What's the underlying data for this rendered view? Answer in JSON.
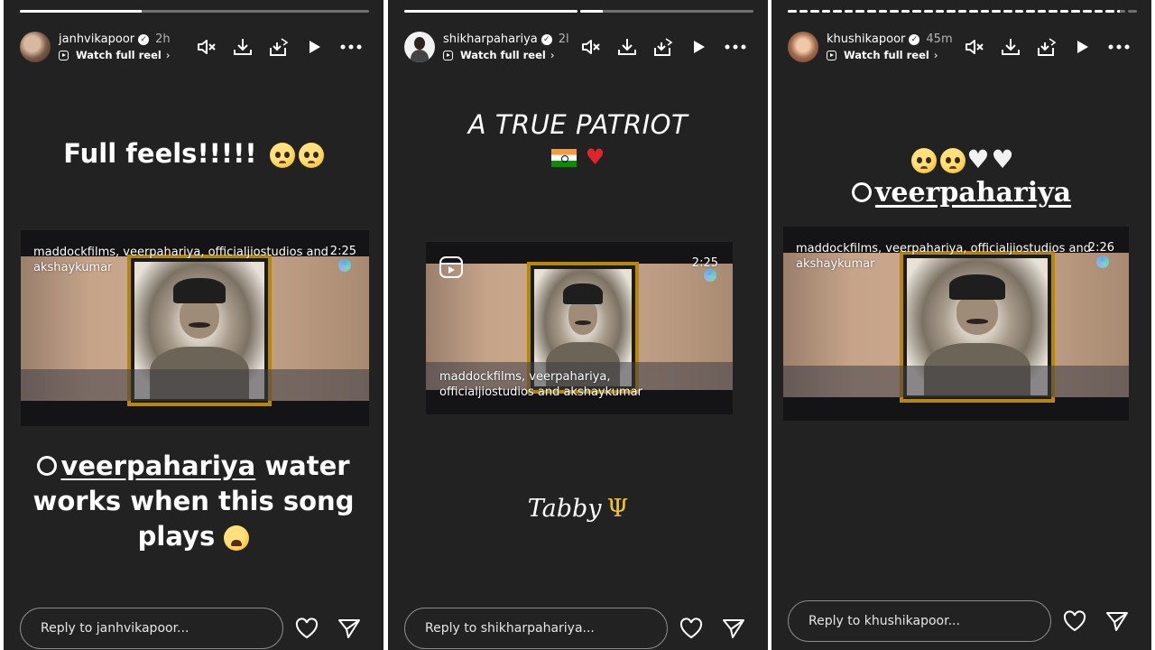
{
  "stories": [
    {
      "username": "janhvikapoor",
      "time": "2h",
      "watch_label": "Watch full reel",
      "progress": [
        0.35
      ],
      "caption_top": "Full feels!!!!!",
      "video": {
        "label_line1": "maddockfilms, veerpahariya, officialjiostudios and",
        "label_line2": "akshaykumar",
        "duration": "2:25"
      },
      "caption_bottom": {
        "mention": "veerpahariya",
        "line1_rest": " water",
        "line2": "works when this song",
        "line3": "plays"
      },
      "reply_placeholder": "Reply to janhvikapoor..."
    },
    {
      "username": "shikharpahariya",
      "time": "2l",
      "watch_label": "Watch full reel",
      "progress": [
        1.0,
        0.13
      ],
      "caption_top": "A TRUE PATRIOT",
      "video": {
        "label_line1": "maddockfilms, veerpahariya,",
        "label_line2": "officialjiostudios and akshaykumar",
        "duration": "2:25"
      },
      "signature": "Tabby",
      "reply_placeholder": "Reply to shikharpahariya..."
    },
    {
      "username": "khushikapoor",
      "time": "45m",
      "watch_label": "Watch full reel",
      "progress": [
        1,
        1,
        1,
        1,
        1,
        1,
        1,
        1,
        1,
        1,
        1,
        1,
        1,
        1,
        1,
        1,
        1,
        1,
        1,
        1,
        1,
        1,
        1,
        1,
        1,
        1,
        1,
        1,
        1,
        0.3,
        0
      ],
      "mention": "veerpahariya",
      "video": {
        "label_line1": "maddockfilms, veerpahariya, officialjiostudios and",
        "label_line2": "akshaykumar",
        "duration": "2:26"
      },
      "reply_placeholder": "Reply to khushikapoor..."
    }
  ],
  "icons": {
    "verified": "verified-badge-icon",
    "mute": "speaker-muted-icon",
    "download": "download-icon",
    "save_reel": "download-reel-icon",
    "play": "play-icon",
    "more": "more-dots-icon",
    "like": "heart-icon",
    "share": "send-icon"
  }
}
